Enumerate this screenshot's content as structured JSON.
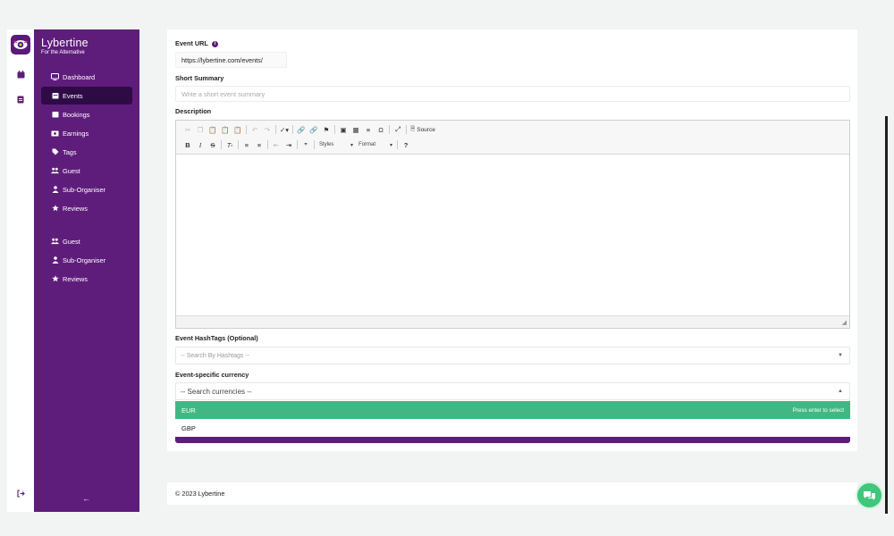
{
  "brand": {
    "name": "Lybertine",
    "tagline": "For the Alternative"
  },
  "sidebar": {
    "items": [
      {
        "label": "Dashboard",
        "icon": "monitor-icon",
        "active": false
      },
      {
        "label": "Events",
        "icon": "calendar-icon",
        "active": true
      },
      {
        "label": "Bookings",
        "icon": "calendar-check-icon",
        "active": false
      },
      {
        "label": "Earnings",
        "icon": "money-icon",
        "active": false
      },
      {
        "label": "Tags",
        "icon": "tag-icon",
        "active": false
      },
      {
        "label": "Guest",
        "icon": "users-icon",
        "active": false
      },
      {
        "label": "Sub-Organiser",
        "icon": "user-icon",
        "active": false
      },
      {
        "label": "Reviews",
        "icon": "star-icon",
        "active": false
      },
      {
        "label": "Guest",
        "icon": "users-icon",
        "active": false
      },
      {
        "label": "Sub-Organiser",
        "icon": "user-icon",
        "active": false
      },
      {
        "label": "Reviews",
        "icon": "star-icon",
        "active": false
      }
    ]
  },
  "form": {
    "event_url": {
      "label": "Event URL",
      "value": "https://lybertine.com/events/"
    },
    "short_summary": {
      "label": "Short Summary",
      "placeholder": "Write a short event summary"
    },
    "description": {
      "label": "Description",
      "toolbar": {
        "source_label": "Source",
        "styles_label": "Styles",
        "format_label": "Format"
      }
    },
    "hashtags": {
      "label": "Event HashTags (Optional)",
      "placeholder": "-- Search By Hashtags --"
    },
    "currency": {
      "label": "Event-specific currency",
      "search_placeholder": "-- Search currencies --",
      "options": [
        "EUR",
        "GBP"
      ],
      "highlighted": "EUR",
      "hint": "Press enter to select"
    }
  },
  "footer": {
    "copyright": "© 2023 Lybertine"
  },
  "colors": {
    "brand_purple": "#5e1d7b",
    "active_item": "#2e0b45",
    "highlight_green": "#41b883",
    "chat_green": "#3fc77b"
  }
}
